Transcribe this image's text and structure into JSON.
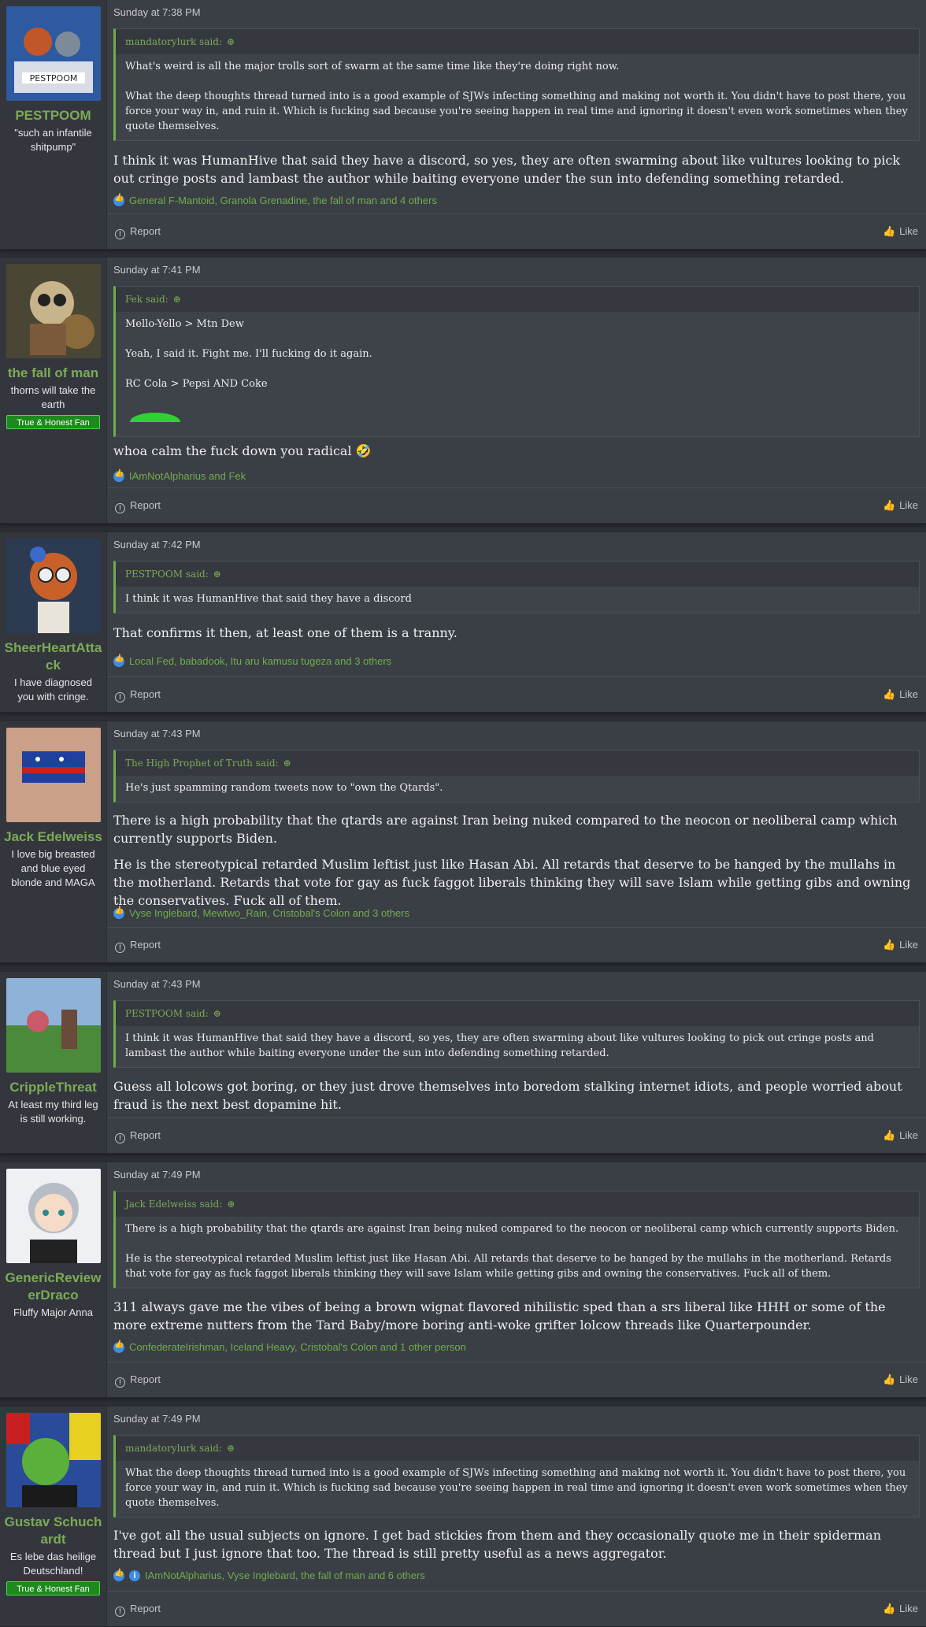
{
  "posts": [
    {
      "user": {
        "name": "PESTPOOM",
        "title": "\"such an infantile shitpump\"",
        "badge": ""
      },
      "time": "Sunday at 7:38 PM",
      "quote": {
        "author": "mandatorylurk said:",
        "paras": [
          "What's weird is all the major trolls sort of swarm at the same time like they're doing right now.",
          "What the deep thoughts thread turned into is a good example of SJWs infecting something and making not worth it. You didn't have to post there, you force your way in, and ruin it. Which is fucking sad because you're seeing happen in real time and ignoring it doesn't even work sometimes when they quote themselves."
        ]
      },
      "message": [
        "I think it was HumanHive that said they have a discord, so yes, they are often swarming about like vultures looking to pick out cringe posts and lambast the author while baiting everyone under the sun into defending something retarded."
      ],
      "reactions": "General F-Mantoid, Granola Grenadine, the fall of man and 4 others",
      "report": "Report",
      "like": "Like"
    },
    {
      "user": {
        "name": "the fall of man",
        "title": "thorns will take the earth",
        "badge": "True & Honest Fan"
      },
      "time": "Sunday at 7:41 PM",
      "quote": {
        "author": "Fek said:",
        "paras": [
          "Mello-Yello > Mtn Dew",
          "Yeah, I said it. Fight me. I'll fucking do it again.",
          "RC Cola > Pepsi AND Coke"
        ]
      },
      "message": [
        "whoa calm the fuck down you radical 🤣"
      ],
      "reactions": "IAmNotAlpharius and Fek",
      "report": "Report",
      "like": "Like"
    },
    {
      "user": {
        "name": "SheerHeartAttack",
        "title": "I have diagnosed you with cringe.",
        "badge": ""
      },
      "time": "Sunday at 7:42 PM",
      "quote": {
        "author": "PESTPOOM said:",
        "paras": [
          "I think it was HumanHive that said they have a discord"
        ]
      },
      "message": [
        "That confirms it then, at least one of them is a tranny."
      ],
      "reactions": "Local Fed, babadook, Itu aru kamusu tugeza and 3 others",
      "report": "Report",
      "like": "Like"
    },
    {
      "user": {
        "name": "Jack Edelweiss",
        "title": "I love big breasted and blue eyed blonde and MAGA",
        "badge": ""
      },
      "time": "Sunday at 7:43 PM",
      "quote": {
        "author": "The High Prophet of Truth said:",
        "paras": [
          "He's just spamming random tweets now to \"own the Qtards\"."
        ]
      },
      "message": [
        "There is a high probability that the qtards are against Iran being nuked compared to the neocon or neoliberal camp which currently supports Biden.",
        "He is the stereotypical retarded Muslim leftist just like Hasan Abi. All retards that deserve to be hanged by the mullahs in the motherland. Retards that vote for gay as fuck faggot liberals thinking they will save Islam while getting gibs and owning the conservatives. Fuck all of them."
      ],
      "reactions": "Vyse Inglebard, Mewtwo_Rain, Cristobal's Colon and 3 others",
      "report": "Report",
      "like": "Like"
    },
    {
      "user": {
        "name": "CrippleThreat",
        "title": "At least my third leg is still working.",
        "badge": ""
      },
      "time": "Sunday at 7:43 PM",
      "quote": {
        "author": "PESTPOOM said:",
        "paras": [
          "I think it was HumanHive that said they have a discord, so yes, they are often swarming about like vultures looking to pick out cringe posts and lambast the author while baiting everyone under the sun into defending something retarded."
        ]
      },
      "message": [
        "Guess all lolcows got boring, or they just drove themselves into boredom stalking internet idiots, and people worried about fraud is the next best dopamine hit."
      ],
      "reactions": "",
      "report": "Report",
      "like": "Like"
    },
    {
      "user": {
        "name": "GenericReviewerDraco",
        "title": "Fluffy Major Anna",
        "badge": ""
      },
      "time": "Sunday at 7:49 PM",
      "quote": {
        "author": "Jack Edelweiss said:",
        "paras": [
          "There is a high probability that the qtards are against Iran being nuked compared to the neocon or neoliberal camp which currently supports Biden.",
          "He is the stereotypical retarded Muslim leftist just like Hasan Abi. All retards that deserve to be hanged by the mullahs in the motherland. Retards that vote for gay as fuck faggot liberals thinking they will save Islam while getting gibs and owning the conservatives. Fuck all of them."
        ]
      },
      "message": [
        "311 always gave me the vibes of being a brown wignat flavored nihilistic sped than a srs liberal like HHH or some of the more extreme nutters from the Tard Baby/more boring anti-woke grifter lolcow threads like Quarterpounder."
      ],
      "reactions": "ConfederateIrishman, Iceland Heavy, Cristobal's Colon and 1 other person",
      "report": "Report",
      "like": "Like"
    },
    {
      "user": {
        "name": "Gustav Schuchardt",
        "title": "Es lebe das heilige Deutschland!",
        "badge": "True & Honest Fan"
      },
      "time": "Sunday at 7:49 PM",
      "quote": {
        "author": "mandatorylurk said:",
        "paras": [
          "What the deep thoughts thread turned into is a good example of SJWs infecting something and making not worth it. You didn't have to post there, you force your way in, and ruin it. Which is fucking sad because you're seeing happen in real time and ignoring it doesn't even work sometimes when they quote themselves."
        ]
      },
      "message": [
        "I've got all the usual subjects on ignore. I get bad stickies from them and they occasionally quote me in their spiderman thread but I just ignore that too. The thread is still pretty useful as a news aggregator."
      ],
      "reactions": "IAmNotAlpharius, Vyse Inglebard, the fall of man and 6 others",
      "report": "Report",
      "like": "Like"
    }
  ]
}
